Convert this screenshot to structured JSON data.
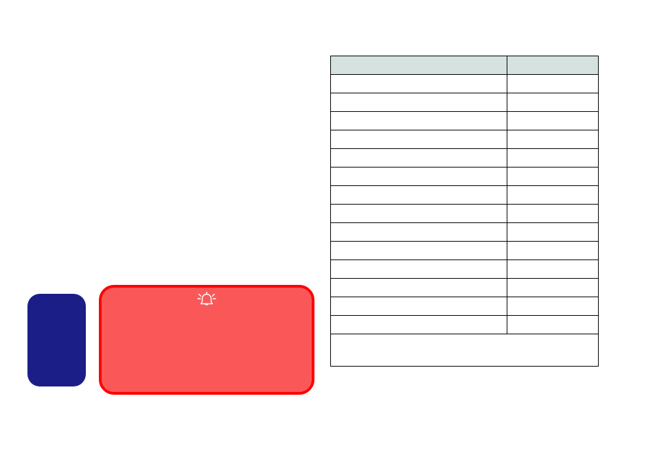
{
  "blue_box": {},
  "red_box": {
    "icon": "bell-alert-icon"
  },
  "table": {
    "headers": [
      "",
      ""
    ],
    "rows": [
      [
        "",
        ""
      ],
      [
        "",
        ""
      ],
      [
        "",
        ""
      ],
      [
        "",
        ""
      ],
      [
        "",
        ""
      ],
      [
        "",
        ""
      ],
      [
        "",
        ""
      ],
      [
        "",
        ""
      ],
      [
        "",
        ""
      ],
      [
        "",
        ""
      ],
      [
        "",
        ""
      ],
      [
        "",
        ""
      ],
      [
        "",
        ""
      ],
      [
        "",
        ""
      ]
    ],
    "footer": ""
  }
}
